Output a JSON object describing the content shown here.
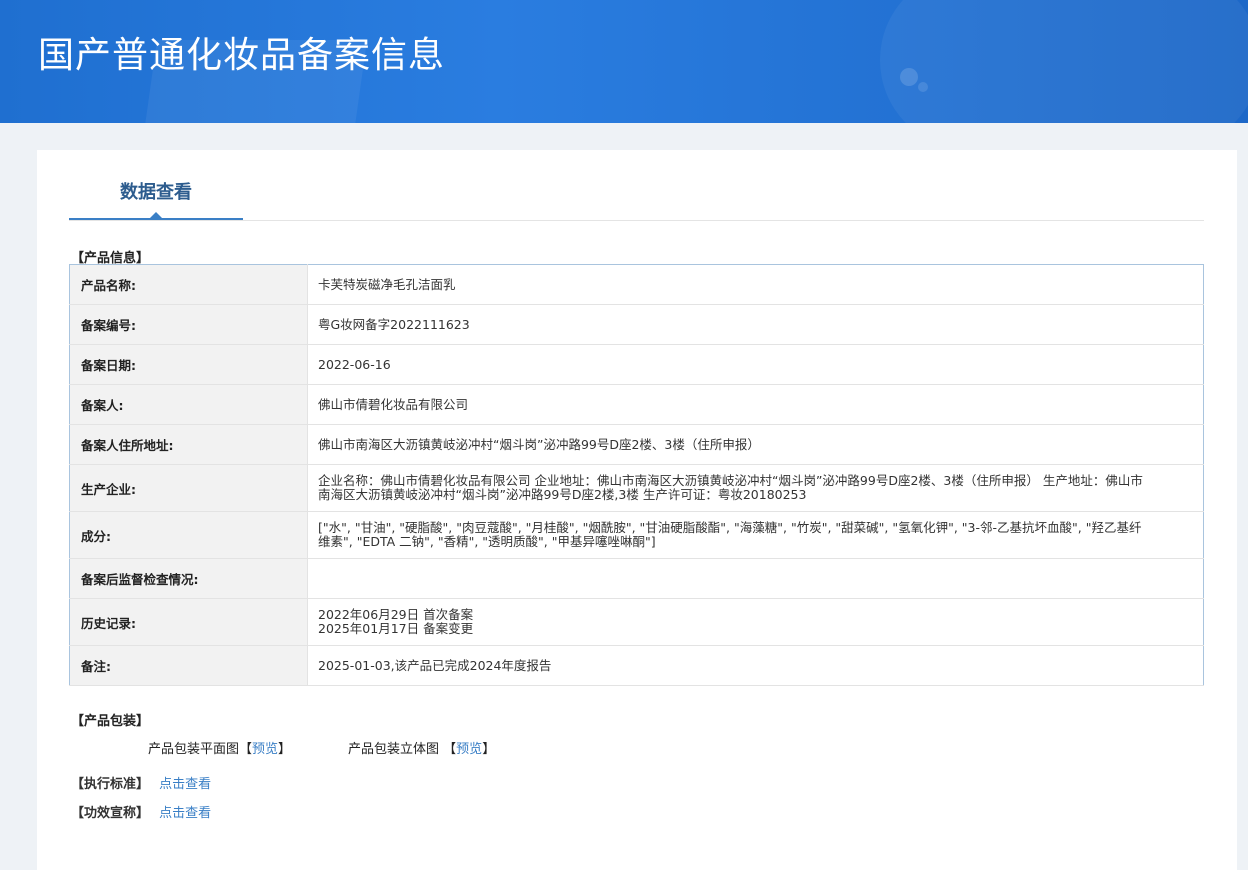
{
  "header": {
    "title": "国产普通化妆品备案信息"
  },
  "tabs": {
    "active": "数据查看"
  },
  "product_info": {
    "section_title": "【产品信息】",
    "rows": [
      {
        "label": "产品名称:",
        "value": "卡芙特炭磁净毛孔洁面乳"
      },
      {
        "label": "备案编号:",
        "value": "粤G妆网备字2022111623"
      },
      {
        "label": "备案日期:",
        "value": "2022-06-16"
      },
      {
        "label": "备案人:",
        "value": "佛山市倩碧化妆品有限公司"
      },
      {
        "label": "备案人住所地址:",
        "value": "佛山市南海区大沥镇黄岐泌冲村“烟斗岗”泌冲路99号D座2楼、3楼（住所申报）"
      },
      {
        "label": "生产企业:",
        "value": "企业名称：佛山市倩碧化妆品有限公司 企业地址：佛山市南海区大沥镇黄岐泌冲村“烟斗岗”泌冲路99号D座2楼、3楼（住所申报） 生产地址：佛山市南海区大沥镇黄岐泌冲村“烟斗岗”泌冲路99号D座2楼,3楼 生产许可证：粤妆20180253"
      },
      {
        "label": "成分:",
        "value": "[\"水\", \"甘油\", \"硬脂酸\", \"肉豆蔻酸\", \"月桂酸\", \"烟酰胺\", \"甘油硬脂酸酯\", \"海藻糖\", \"竹炭\", \"甜菜碱\", \"氢氧化钾\", \"3-邻-乙基抗坏血酸\", \"羟乙基纤维素\", \"EDTA 二钠\", \"香精\", \"透明质酸\", \"甲基异噻唑啉酮\"]"
      },
      {
        "label": "备案后监督检查情况:",
        "value": ""
      },
      {
        "label": "历史记录:",
        "value": "2022年06月29日 首次备案\n2025年01月17日 备案变更"
      },
      {
        "label": "备注:",
        "value": "2025-01-03,该产品已完成2024年度报告"
      }
    ]
  },
  "packaging": {
    "section_title": "【产品包装】",
    "flat_label": "产品包装平面图",
    "flat_link": "预览",
    "solid_label": "产品包装立体图",
    "solid_link": "预览",
    "bracket_open": "【",
    "bracket_close": "】"
  },
  "standard": {
    "label": "【执行标准】",
    "link": "点击查看"
  },
  "efficacy": {
    "label": "【功效宣称】",
    "link": "点击查看"
  }
}
